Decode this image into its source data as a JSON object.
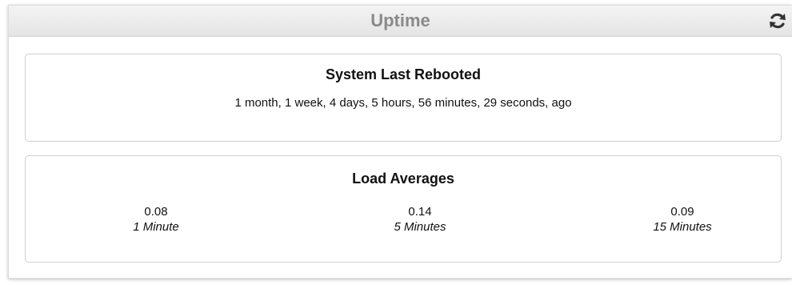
{
  "widget": {
    "title": "Uptime",
    "refresh_icon": "refresh-icon"
  },
  "reboot": {
    "heading": "System Last Rebooted",
    "value": "1 month, 1 week, 4 days, 5 hours, 56 minutes, 29 seconds, ago"
  },
  "load": {
    "heading": "Load Averages",
    "items": [
      {
        "value": "0.08",
        "label": "1 Minute"
      },
      {
        "value": "0.14",
        "label": "5 Minutes"
      },
      {
        "value": "0.09",
        "label": "15 Minutes"
      }
    ]
  },
  "colors": {
    "title_text": "#8a8a8a",
    "header_bg": "#e8e8e8",
    "panel_border": "#cfcfcf",
    "body_text": "#111111"
  }
}
